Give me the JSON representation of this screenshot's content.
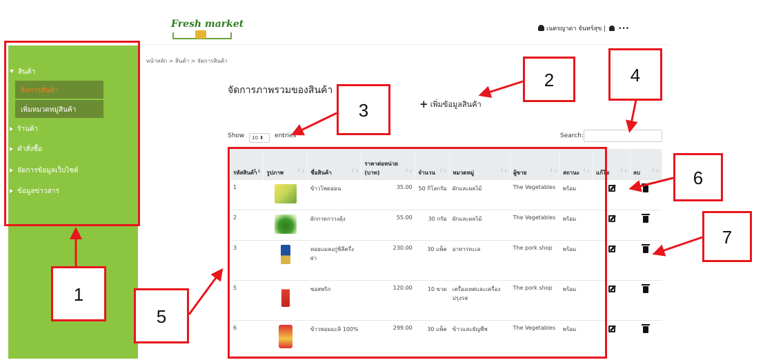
{
  "header": {
    "logo_text": "Fresh market",
    "user_name": "เนตรญาดา จันทร์สุข |",
    "more": "•••"
  },
  "sidebar": {
    "items": [
      {
        "label": "สินค้า",
        "expanded": true
      },
      {
        "label": "ร้านค้า"
      },
      {
        "label": "คำสั่งซื้อ"
      },
      {
        "label": "จัดการข้อมูลเว็บไซต์"
      },
      {
        "label": "ข้อมูลข่าวสาร"
      }
    ],
    "subitems": [
      {
        "label": "จัดการสินค้า",
        "active": true
      },
      {
        "label": "เพิ่มหมวดหมู่สินค้า"
      }
    ]
  },
  "breadcrumb": "หน้าหลัก > สินค้า > จัดการสินค้า",
  "page_title": "จัดการภาพรวมของสินค้า",
  "add_button": "เพิ่มข้อมูลสินค้า",
  "show": {
    "prefix": "Show",
    "value": "10",
    "suffix": "entries"
  },
  "search_label": "Search:",
  "table": {
    "headers": [
      "รหัสสินค้า",
      "รูปภาพ",
      "ชื่อสินค้า",
      "ราคาต่อหน่วย (บาท)",
      "จำนวน",
      "หมวดหมู่",
      "ผู้ขาย",
      "สถานะ",
      "แก้ไข",
      "ลบ"
    ],
    "rows": [
      {
        "id": "1",
        "image": "corn",
        "name": "ข้าวโพดอ่อน",
        "price": "35.00",
        "qty": "50 กิโลกรัม",
        "category": "ผักและผลไม้",
        "seller": "The Vegetables",
        "status": "พร้อม"
      },
      {
        "id": "2",
        "image": "greens",
        "name": "ผักกาดกวางตุ้ง",
        "price": "55.00",
        "qty": "30 กรัม",
        "category": "ผักและผลไม้",
        "seller": "The Vegetables",
        "status": "พร้อม"
      },
      {
        "id": "3",
        "image": "can",
        "name": "หอยแมลงภู่ชิลีครึ่งฝา",
        "price": "230.00",
        "qty": "30 แพ็ค",
        "category": "อาหารทะเล",
        "seller": "The pork shop",
        "status": "พร้อม"
      },
      {
        "id": "5",
        "image": "bottle",
        "name": "ซอสพริก",
        "price": "120.00",
        "qty": "10 ขวด",
        "category": "เครื่องเทศและเครื่องปรุงรส",
        "seller": "The pork shop",
        "status": "พร้อม"
      },
      {
        "id": "6",
        "image": "rice",
        "name": "ข้าวหอมมะลิ 100%",
        "price": "299.00",
        "qty": "30 แพ็ค",
        "category": "ข้าวและธัญพืช",
        "seller": "The Vegetables",
        "status": "พร้อม"
      }
    ]
  },
  "callouts": [
    "1",
    "2",
    "3",
    "4",
    "5",
    "6",
    "7"
  ],
  "colors": {
    "sidebar": "#8cc540",
    "submenu": "#6a8d33",
    "active": "#f07f20",
    "callout_border": "#e8161d"
  }
}
